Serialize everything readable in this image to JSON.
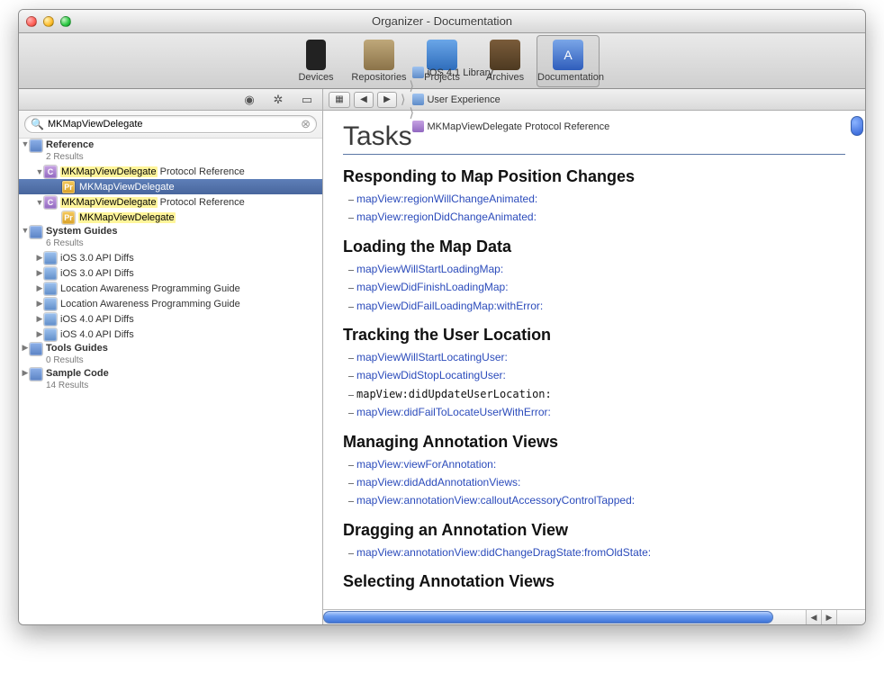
{
  "window": {
    "title": "Organizer - Documentation"
  },
  "toolbar": [
    {
      "id": "devices",
      "label": "Devices",
      "selected": false
    },
    {
      "id": "repositories",
      "label": "Repositories",
      "selected": false
    },
    {
      "id": "projects",
      "label": "Projects",
      "selected": false
    },
    {
      "id": "archives",
      "label": "Archives",
      "selected": false
    },
    {
      "id": "documentation",
      "label": "Documentation",
      "selected": true
    }
  ],
  "sidebar": {
    "search": {
      "value": "MKMapViewDelegate",
      "prefix_icon": "magnifier"
    },
    "groups": [
      {
        "title": "Reference",
        "subtitle": "2 Results",
        "items": [
          {
            "type": "protocol-ref",
            "label": "MKMapViewDelegate Protocol Reference",
            "hl": "MKMapViewDelegate",
            "children": [
              {
                "type": "protocol",
                "label": "MKMapViewDelegate",
                "hl": "MKMapViewDelegate",
                "selected": true
              }
            ]
          },
          {
            "type": "protocol-ref",
            "label": "MKMapViewDelegate Protocol Reference",
            "hl": "MKMapViewDelegate",
            "children": [
              {
                "type": "protocol",
                "label": "MKMapViewDelegate",
                "hl": "MKMapViewDelegate"
              }
            ]
          }
        ]
      },
      {
        "title": "System Guides",
        "subtitle": "6 Results",
        "items": [
          {
            "type": "doc",
            "label": "iOS 3.0 API Diffs"
          },
          {
            "type": "doc",
            "label": "iOS 3.0 API Diffs"
          },
          {
            "type": "doc",
            "label": "Location Awareness Programming Guide"
          },
          {
            "type": "doc",
            "label": "Location Awareness Programming Guide"
          },
          {
            "type": "doc",
            "label": "iOS 4.0 API Diffs"
          },
          {
            "type": "doc",
            "label": "iOS 4.0 API Diffs"
          }
        ]
      },
      {
        "title": "Tools Guides",
        "subtitle": "0 Results",
        "items": []
      },
      {
        "title": "Sample Code",
        "subtitle": "14 Results",
        "items": []
      }
    ]
  },
  "path": {
    "crumbs": [
      {
        "icon": "lib",
        "label": "iOS 4.1 Library"
      },
      {
        "icon": "ux",
        "label": "User Experience"
      },
      {
        "icon": "C",
        "label": "MKMapViewDelegate Protocol Reference"
      }
    ]
  },
  "doc": {
    "title": "Tasks",
    "sections": [
      {
        "heading": "Responding to Map Position Changes",
        "methods": [
          {
            "text": "mapView:regionWillChangeAnimated:",
            "link": true
          },
          {
            "text": "mapView:regionDidChangeAnimated:",
            "link": true
          }
        ]
      },
      {
        "heading": "Loading the Map Data",
        "methods": [
          {
            "text": "mapViewWillStartLoadingMap:",
            "link": true
          },
          {
            "text": "mapViewDidFinishLoadingMap:",
            "link": true
          },
          {
            "text": "mapViewDidFailLoadingMap:withError:",
            "link": true
          }
        ]
      },
      {
        "heading": "Tracking the User Location",
        "methods": [
          {
            "text": "mapViewWillStartLocatingUser:",
            "link": true
          },
          {
            "text": "mapViewDidStopLocatingUser:",
            "link": true
          },
          {
            "text": "mapView:didUpdateUserLocation:",
            "link": false
          },
          {
            "text": "mapView:didFailToLocateUserWithError:",
            "link": true
          }
        ]
      },
      {
        "heading": "Managing Annotation Views",
        "methods": [
          {
            "text": "mapView:viewForAnnotation:",
            "link": true
          },
          {
            "text": "mapView:didAddAnnotationViews:",
            "link": true
          },
          {
            "text": "mapView:annotationView:calloutAccessoryControlTapped:",
            "link": true
          }
        ]
      },
      {
        "heading": "Dragging an Annotation View",
        "methods": [
          {
            "text": "mapView:annotationView:didChangeDragState:fromOldState:",
            "link": true
          }
        ]
      }
    ],
    "cutoff_heading": "Selecting Annotation Views"
  }
}
